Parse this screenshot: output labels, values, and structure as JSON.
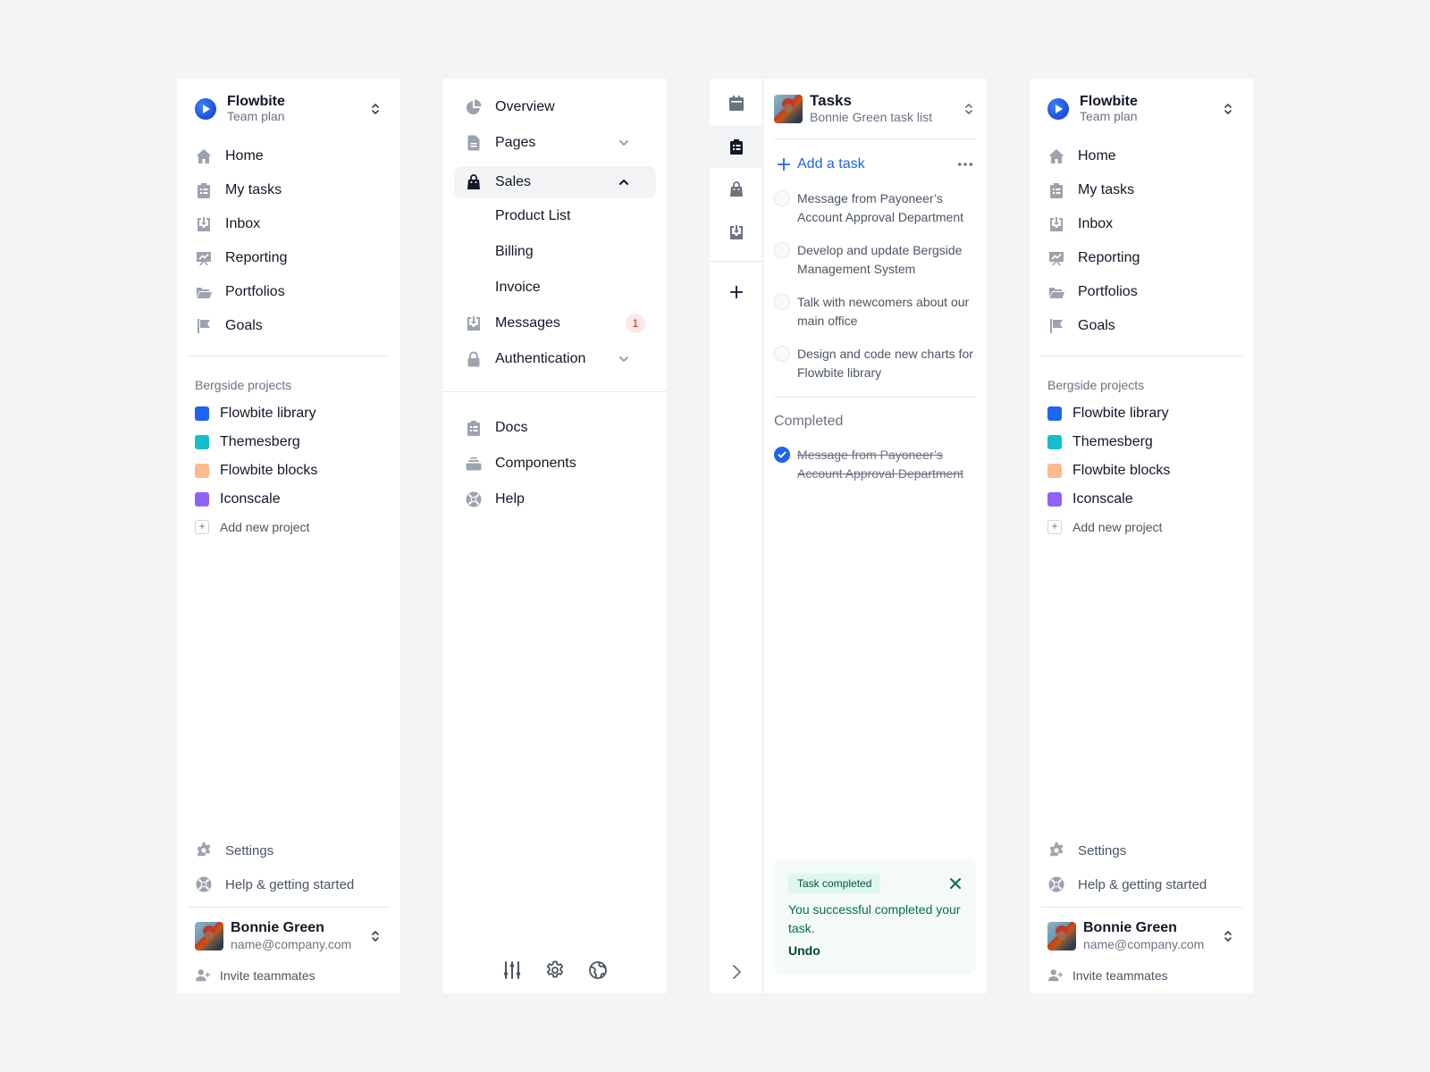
{
  "sidebar": {
    "brand_title": "Flowbite",
    "brand_subtitle": "Team plan",
    "nav": [
      {
        "label": "Home",
        "icon": "home-icon"
      },
      {
        "label": "My tasks",
        "icon": "clipboard-list-icon"
      },
      {
        "label": "Inbox",
        "icon": "inbox-icon"
      },
      {
        "label": "Reporting",
        "icon": "presentation-chart-icon"
      },
      {
        "label": "Portfolios",
        "icon": "folder-icon"
      },
      {
        "label": "Goals",
        "icon": "flag-icon"
      }
    ],
    "projects_title": "Bergside projects",
    "projects": [
      {
        "label": "Flowbite library",
        "color": "#1c64f2"
      },
      {
        "label": "Themesberg",
        "color": "#16bdca"
      },
      {
        "label": "Flowbite blocks",
        "color": "#fdba8c"
      },
      {
        "label": "Iconscale",
        "color": "#9061f9"
      }
    ],
    "add_project": "Add new project",
    "settings": "Settings",
    "help": "Help & getting started",
    "user_name": "Bonnie Green",
    "user_email": "name@company.com",
    "invite": "Invite teammates"
  },
  "navbar": {
    "items": [
      {
        "label": "Overview"
      },
      {
        "label": "Pages"
      },
      {
        "label": "Sales"
      },
      {
        "label": "Messages",
        "badge": "1"
      },
      {
        "label": "Authentication"
      }
    ],
    "sales_sub": [
      "Product List",
      "Billing",
      "Invoice"
    ],
    "secondary": [
      {
        "label": "Docs"
      },
      {
        "label": "Components"
      },
      {
        "label": "Help"
      }
    ]
  },
  "tasks": {
    "title": "Tasks",
    "subtitle": "Bonnie Green task list",
    "add_task": "Add a task",
    "open": [
      "Message from Payoneer’s Account Approval Department",
      "Develop and update Bergside Management System",
      "Talk with newcomers about our main office",
      "Design and code new charts for Flowbite library"
    ],
    "completed_title": "Completed",
    "completed": [
      "Message from Payoneer’s Account Approval Department"
    ],
    "toast": {
      "badge": "Task completed",
      "message": "You successful completed your task.",
      "undo": "Undo"
    }
  }
}
